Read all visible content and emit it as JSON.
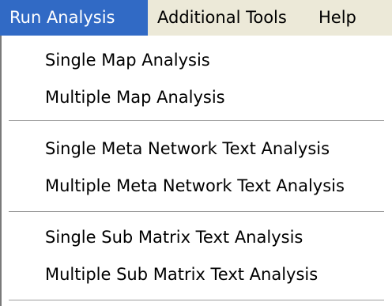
{
  "menubar": {
    "items": [
      {
        "label": "Run Analysis"
      },
      {
        "label": "Additional Tools"
      },
      {
        "label": "Help"
      }
    ]
  },
  "dropdown": {
    "groups": [
      {
        "items": [
          {
            "label": "Single Map Analysis"
          },
          {
            "label": "Multiple Map Analysis"
          }
        ]
      },
      {
        "items": [
          {
            "label": "Single Meta Network Text Analysis"
          },
          {
            "label": "Multiple Meta Network Text Analysis"
          }
        ]
      },
      {
        "items": [
          {
            "label": "Single Sub Matrix Text Analysis"
          },
          {
            "label": "Multiple Sub Matrix Text Analysis"
          }
        ]
      }
    ]
  },
  "colors": {
    "menubar_bg": "#ece9d8",
    "highlight_bg": "#316ac5",
    "highlight_text": "#ffffff",
    "dropdown_bg": "#ffffff"
  }
}
